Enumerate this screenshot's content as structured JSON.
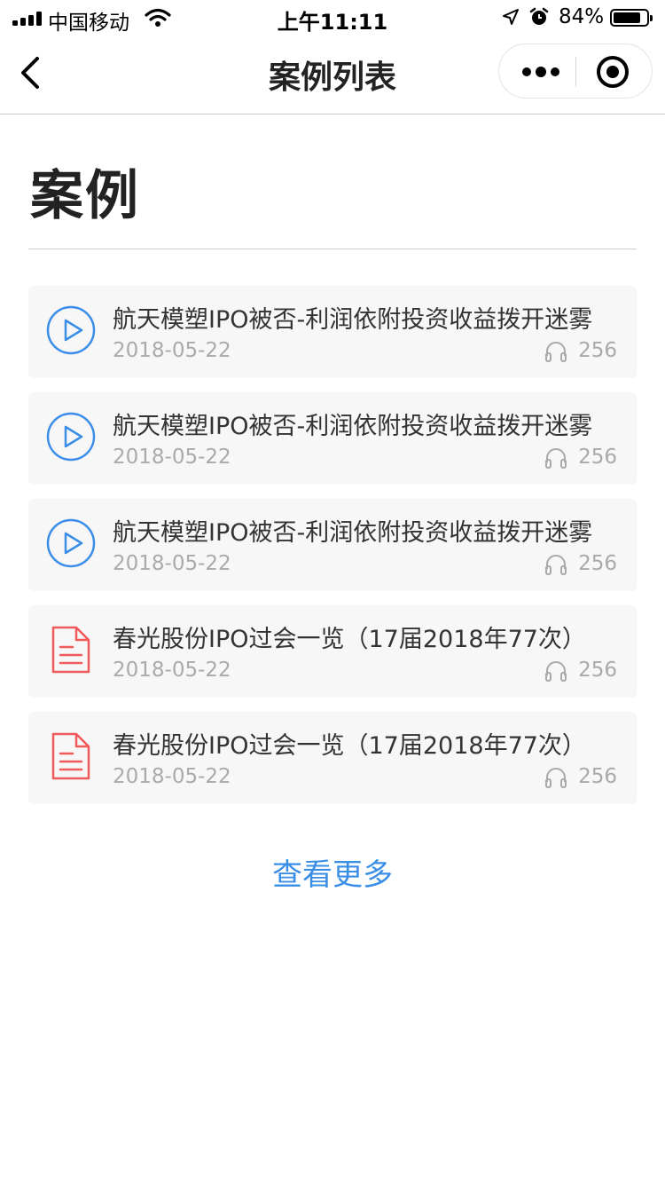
{
  "status_bar": {
    "carrier": "中国移动",
    "time": "上午11:11",
    "battery_percent": "84%",
    "battery_level": 0.84,
    "icons": [
      "signal-icon",
      "wifi-icon",
      "location-icon",
      "alarm-icon",
      "battery-icon"
    ]
  },
  "nav": {
    "title": "案例列表",
    "back_icon": "chevron-left-icon",
    "more_icon": "more-dots-icon",
    "close_icon": "target-circle-icon"
  },
  "page": {
    "heading": "案例",
    "view_more": "查看更多"
  },
  "colors": {
    "video_icon": "#3a8ee6",
    "document_icon": "#f05a5a",
    "link": "#3a8ee6",
    "meta_text": "#aaaaaa",
    "card_background": "#f7f7f7"
  },
  "cases": [
    {
      "type": "video",
      "icon": "play-circle-icon",
      "title": "航天模塑IPO被否-利润依附投资收益拨开迷雾",
      "date": "2018-05-22",
      "count": "256"
    },
    {
      "type": "video",
      "icon": "play-circle-icon",
      "title": "航天模塑IPO被否-利润依附投资收益拨开迷雾",
      "date": "2018-05-22",
      "count": "256"
    },
    {
      "type": "video",
      "icon": "play-circle-icon",
      "title": "航天模塑IPO被否-利润依附投资收益拨开迷雾",
      "date": "2018-05-22",
      "count": "256"
    },
    {
      "type": "document",
      "icon": "document-icon",
      "title": "春光股份IPO过会一览（17届2018年77次）",
      "date": "2018-05-22",
      "count": "256"
    },
    {
      "type": "document",
      "icon": "document-icon",
      "title": "春光股份IPO过会一览（17届2018年77次）",
      "date": "2018-05-22",
      "count": "256"
    }
  ]
}
